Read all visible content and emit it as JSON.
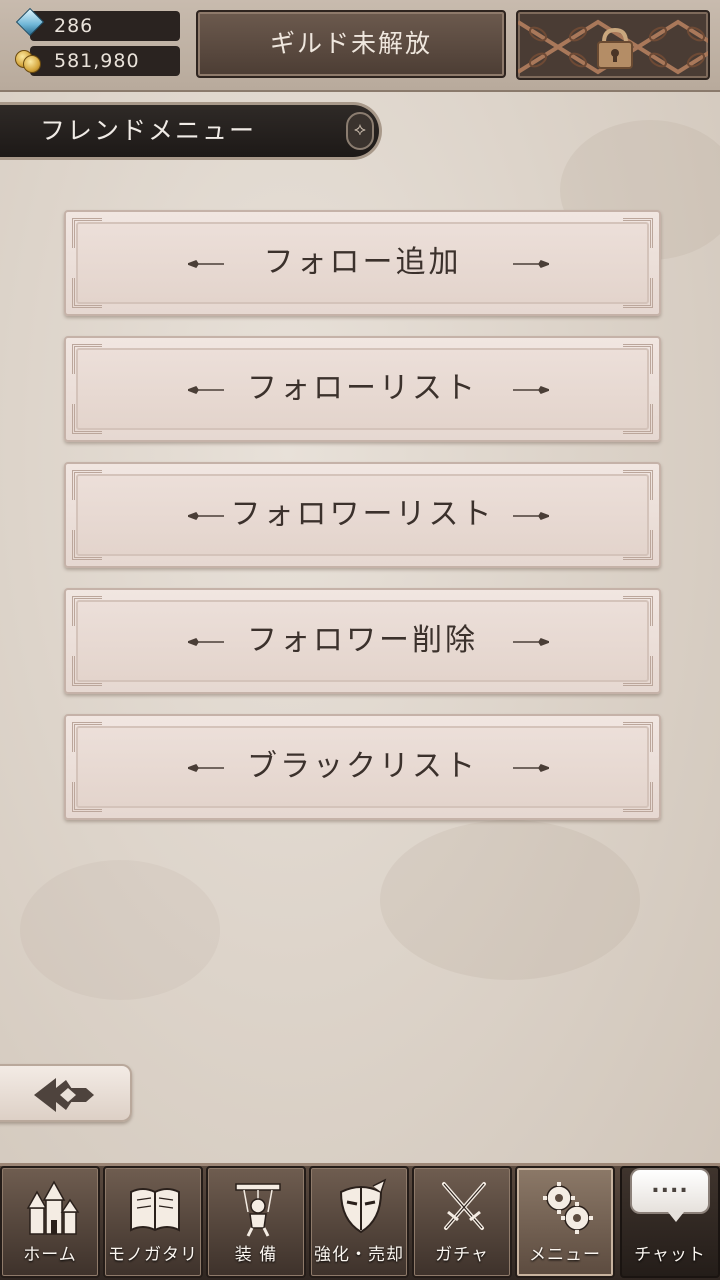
{
  "header": {
    "gems": "286",
    "gold": "581,980",
    "guild_label": "ギルド未解放",
    "locked_icon": "padlock-chain-icon"
  },
  "section": {
    "title": "フレンドメニュー"
  },
  "menu": {
    "items": [
      {
        "label": "フォロー追加"
      },
      {
        "label": "フォローリスト"
      },
      {
        "label": "フォロワーリスト"
      },
      {
        "label": "フォロワー削除"
      },
      {
        "label": "ブラックリスト"
      }
    ]
  },
  "back": {
    "icon": "back-arrow-icon"
  },
  "nav": {
    "items": [
      {
        "label": "ホーム",
        "icon": "castle-icon"
      },
      {
        "label": "モノガタリ",
        "icon": "book-icon"
      },
      {
        "label": "装 備",
        "icon": "puppet-icon"
      },
      {
        "label": "強化・売却",
        "icon": "mask-icon"
      },
      {
        "label": "ガチャ",
        "icon": "crossed-swords-icon"
      },
      {
        "label": "メニュー",
        "icon": "gears-icon"
      }
    ],
    "chat": {
      "bubble": "....",
      "label": "チャット"
    }
  },
  "colors": {
    "background": "#ddd4ca",
    "nav_background": "#3e322b",
    "button_face": "#ecdfd9"
  }
}
